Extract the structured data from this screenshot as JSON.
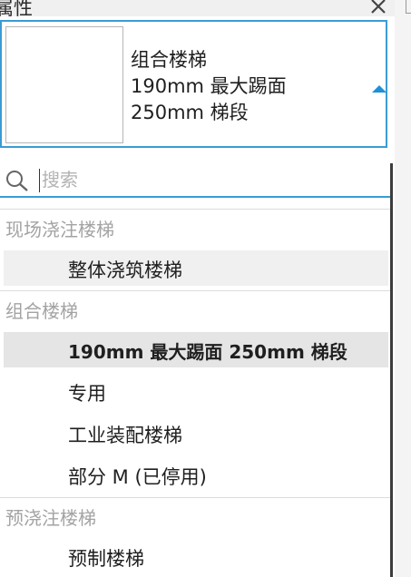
{
  "panel": {
    "title": "属性"
  },
  "type_selector": {
    "line1": "组合楼梯",
    "line2": "190mm 最大踢面",
    "line3": "250mm 梯段"
  },
  "search": {
    "placeholder": "搜索",
    "value": ""
  },
  "groups": [
    {
      "header": "现场浇注楼梯",
      "items": [
        {
          "label": "整体浇筑楼梯"
        }
      ]
    },
    {
      "header": "组合楼梯",
      "items": [
        {
          "label": "190mm 最大踢面 250mm 梯段"
        },
        {
          "label": "专用"
        },
        {
          "label": "工业装配楼梯"
        },
        {
          "label": "部分 M (已停用)"
        }
      ]
    },
    {
      "header": "预浇注楼梯",
      "items": [
        {
          "label": "预制楼梯"
        }
      ]
    }
  ],
  "colors": {
    "accent": "#3a9bd5",
    "caret": "#1e90d6",
    "group_header": "#a3a3a3",
    "selected_bg": "#e5e5e5"
  },
  "icons": [
    "close-icon",
    "dropdown-caret-icon",
    "search-icon"
  ]
}
